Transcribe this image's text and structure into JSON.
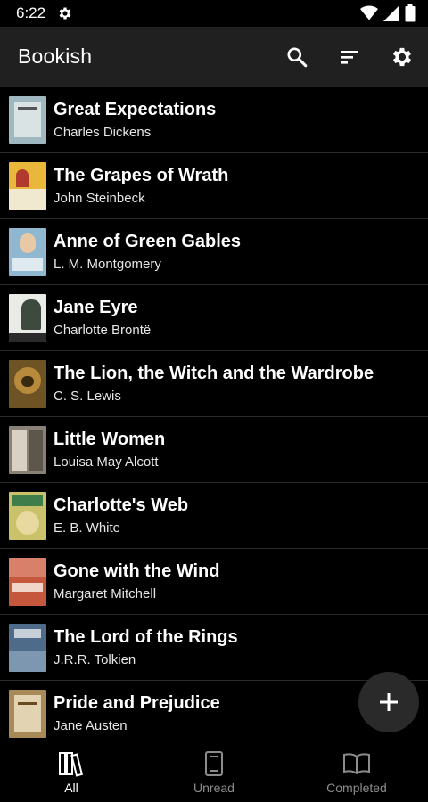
{
  "status_bar": {
    "time": "6:22"
  },
  "app_bar": {
    "title": "Bookish",
    "actions": [
      "search-icon",
      "sort-icon",
      "settings-icon"
    ]
  },
  "books": [
    {
      "title": "Great Expectations",
      "author": "Charles Dickens",
      "cover_color": "#9fb8c0"
    },
    {
      "title": "The Grapes of Wrath",
      "author": "John Steinbeck",
      "cover_color": "#e9b73a"
    },
    {
      "title": "Anne of Green Gables",
      "author": "L. M. Montgomery",
      "cover_color": "#8fb7cf"
    },
    {
      "title": "Jane Eyre",
      "author": "Charlotte Brontë",
      "cover_color": "#5c6a5a"
    },
    {
      "title": "The Lion, the Witch and the Wardrobe",
      "author": "C. S. Lewis",
      "cover_color": "#6e5424"
    },
    {
      "title": "Little Women",
      "author": "Louisa May Alcott",
      "cover_color": "#8a8176"
    },
    {
      "title": "Charlotte's Web",
      "author": "E. B. White",
      "cover_color": "#c9c26a"
    },
    {
      "title": "Gone with the Wind",
      "author": "Margaret Mitchell",
      "cover_color": "#c4573c"
    },
    {
      "title": "The Lord of the Rings",
      "author": "J.R.R. Tolkien",
      "cover_color": "#4f6b8a"
    },
    {
      "title": "Pride and Prejudice",
      "author": "Jane Austen",
      "cover_color": "#a88a58"
    }
  ],
  "fab": {
    "icon": "plus-icon"
  },
  "bottom_nav": {
    "items": [
      {
        "label": "All",
        "icon": "books-icon",
        "selected": true
      },
      {
        "label": "Unread",
        "icon": "closed-book-icon",
        "selected": false
      },
      {
        "label": "Completed",
        "icon": "open-book-icon",
        "selected": false
      }
    ],
    "active_color": "#ffffff",
    "inactive_color": "#8c8c8c"
  }
}
